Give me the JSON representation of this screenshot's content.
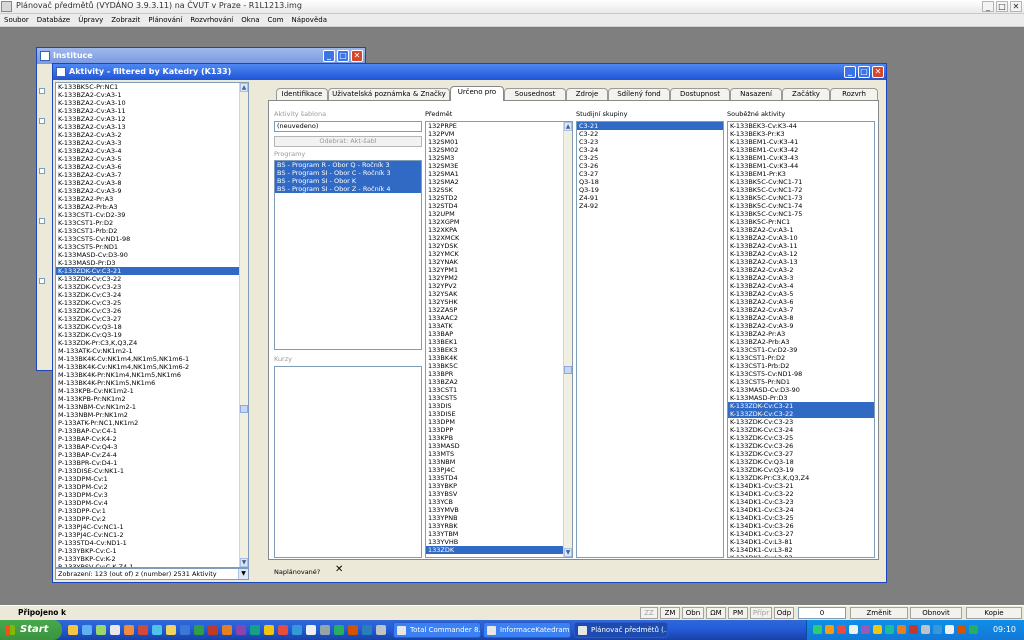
{
  "app": {
    "title": "Plánovač předmětů (VYDÁNO 3.9.3.11) na ČVUT v Praze - R1L1213.img",
    "ctrl_min": "_",
    "ctrl_max": "□",
    "ctrl_close": "✕"
  },
  "menu": [
    "Soubor",
    "Databáze",
    "Úpravy",
    "Zobrazit",
    "Plánování",
    "Rozvrhování",
    "Okna",
    "Com",
    "Nápověda"
  ],
  "instituce_window": {
    "title": "Instituce"
  },
  "aktivity_window": {
    "title": "Aktivity - filtered by Katedry (K133)",
    "list_items": [
      "K-133BK5C-Pr:NC1",
      "K-133BZA2-Cv:A3-1",
      "K-133BZA2-Cv:A3-10",
      "K-133BZA2-Cv:A3-11",
      "K-133BZA2-Cv:A3-12",
      "K-133BZA2-Cv:A3-13",
      "K-133BZA2-Cv:A3-2",
      "K-133BZA2-Cv:A3-3",
      "K-133BZA2-Cv:A3-4",
      "K-133BZA2-Cv:A3-5",
      "K-133BZA2-Cv:A3-6",
      "K-133BZA2-Cv:A3-7",
      "K-133BZA2-Cv:A3-8",
      "K-133BZA2-Cv:A3-9",
      "K-133BZA2-Pr:A3",
      "K-133BZA2-Prb:A3",
      "K-133CST1-Cv:D2-39",
      "K-133CST1-Pr:D2",
      "K-133CST1-Prb:D2",
      "K-133CST5-Cv:ND1-98",
      "K-133CST5-Pr:ND1",
      "K-133MASD-Cv:D3-90",
      "K-133MASD-Pr:D3",
      "K-133ZDK-Cv:C3-21",
      "K-133ZDK-Cv:C3-22",
      "K-133ZDK-Cv:C3-23",
      "K-133ZDK-Cv:C3-24",
      "K-133ZDK-Cv:C3-25",
      "K-133ZDK-Cv:C3-26",
      "K-133ZDK-Cv:C3-27",
      "K-133ZDK-Cv:Q3-18",
      "K-133ZDK-Cv:Q3-19",
      "K-133ZDK-Pr:C3,K,Q3,Z4",
      "M-133ATK-Cv:NK1m2-1",
      "M-133BK4K-Cv:NK1m4,NK1m5,NK1m6-1",
      "M-133BK4K-Cv:NK1m4,NK1m5,NK1m6-2",
      "M-133BK4K-Pr:NK1m4,NK1m5,NK1m6",
      "M-133BK4K-Pr:NK1m5,NK1m6",
      "M-133KPB-Cv:NK1m2-1",
      "M-133KPB-Pr:NK1m2",
      "M-133NBM-Cv:NK1m2-1",
      "M-133NBM-Pr:NK1m2",
      "P-133ATK-Pr:NC1,NK1m2",
      "P-133BAP-Cv:C4-1",
      "P-133BAP-Cv:K4-2",
      "P-133BAP-Cv:Q4-3",
      "P-133BAP-Cv:Z4-4",
      "P-133BPR-Cv:D4-1",
      "P-133DISE-Cv:NK1-1",
      "P-133DPM-Cv:1",
      "P-133DPM-Cv:2",
      "P-133DPM-Cv:3",
      "P-133DPM-Cv:4",
      "P-133DPP-Cv:1",
      "P-133DPP-Cv:2",
      "P-133PJ4C-Cv:NC1-1",
      "P-133PJ4C-Cv:NC1-2",
      "P-133STD4-Cv:ND1-1",
      "P-133YBKP-Cv:C-1",
      "P-133YBKP-Cv:K-2",
      "P-133YBSV-Cv:C,K,Z4-1"
    ],
    "selected_index": 23,
    "status": "Zobrazení: 123 (out of) z (number) 2531 Aktivity",
    "status_btn": "▼",
    "tabs": [
      "Identifikace",
      "Uživatelská poznámka & Značky",
      "Určeno pro",
      "Sousednost",
      "Zdroje",
      "Sdílený fond",
      "Dostupnost",
      "Nasazení",
      "Začátky",
      "Rozvrh"
    ],
    "active_tab": 2,
    "panel": {
      "sablona_label": "Aktivity šablona",
      "sablona_value": "(neuvedeno)",
      "odebrat_button": "Odebrat: Akt-šabl",
      "programy_label": "Programy",
      "programy": [
        "BS - Program R - Obor Q - Ročník 3",
        "BS - Program SI - Obor C - Ročník 3",
        "BS - Program SI - Obor K",
        "BS - Program SI - Obor Z - Ročník 4"
      ],
      "kurzy_label": "Kurzy",
      "predmet_label": "Předmět",
      "predmety": [
        "132PRPE",
        "132PVM",
        "132SM01",
        "132SM02",
        "132SM3",
        "132SM3E",
        "132SMA1",
        "132SMA2",
        "132SSK",
        "132STD2",
        "132STD4",
        "132UPM",
        "132XGPM",
        "132XKPA",
        "132XMCK",
        "132YDSK",
        "132YMCK",
        "132YNAK",
        "132YPM1",
        "132YPM2",
        "132YPV2",
        "132YSAK",
        "132YSHK",
        "132ZASP",
        "133AAC2",
        "133ATK",
        "133BAP",
        "133BEK1",
        "133BEK3",
        "133BK4K",
        "133BK5C",
        "133BPR",
        "133BZA2",
        "133CST1",
        "133CST5",
        "133DIS",
        "133DISE",
        "133DPM",
        "133DPP",
        "133KPB",
        "133MASD",
        "133MTS",
        "133NBM",
        "133PJ4C",
        "133STD4",
        "133YBKP",
        "133YBSV",
        "133YCB",
        "133YMVB",
        "133YPNB",
        "133YRBK",
        "133YTBM",
        "133YVHB",
        "133ZDK"
      ],
      "predmet_selected": 53,
      "skupiny_label": "Studijní skupiny",
      "skupiny": [
        "C3-21",
        "C3-22",
        "C3-23",
        "C3-24",
        "C3-25",
        "C3-26",
        "C3-27",
        "Q3-18",
        "Q3-19",
        "Z4-91",
        "Z4-92"
      ],
      "skupiny_selected": 0,
      "soubezne_label": "Souběžné aktivity",
      "soubezne": [
        "K-133BEK3-Cv:K3-44",
        "K-133BEK3-Pr:K3",
        "K-133BEM1-Cv:K3-41",
        "K-133BEM1-Cv:K3-42",
        "K-133BEM1-Cv:K3-43",
        "K-133BEM1-Cv:K3-44",
        "K-133BEM1-Pr:K3",
        "K-133BK5C-Cv:NC1-71",
        "K-133BK5C-Cv:NC1-72",
        "K-133BK5C-Cv:NC1-73",
        "K-133BK5C-Cv:NC1-74",
        "K-133BK5C-Cv:NC1-75",
        "K-133BK5C-Pr:NC1",
        "K-133BZA2-Cv:A3-1",
        "K-133BZA2-Cv:A3-10",
        "K-133BZA2-Cv:A3-11",
        "K-133BZA2-Cv:A3-12",
        "K-133BZA2-Cv:A3-13",
        "K-133BZA2-Cv:A3-2",
        "K-133BZA2-Cv:A3-3",
        "K-133BZA2-Cv:A3-4",
        "K-133BZA2-Cv:A3-5",
        "K-133BZA2-Cv:A3-6",
        "K-133BZA2-Cv:A3-7",
        "K-133BZA2-Cv:A3-8",
        "K-133BZA2-Cv:A3-9",
        "K-133BZA2-Pr:A3",
        "K-133BZA2-Prb:A3",
        "K-133CST1-Cv:D2-39",
        "K-133CST1-Pr:D2",
        "K-133CST1-Prb:D2",
        "K-133CST5-Cv:ND1-98",
        "K-133CST5-Pr:ND1",
        "K-133MASD-Cv:D3-90",
        "K-133MASD-Pr:D3",
        "K-133ZDK-Cv:C3-21",
        "K-133ZDK-Cv:C3-22",
        "K-133ZDK-Cv:C3-23",
        "K-133ZDK-Cv:C3-24",
        "K-133ZDK-Cv:C3-25",
        "K-133ZDK-Cv:C3-26",
        "K-133ZDK-Cv:C3-27",
        "K-133ZDK-Cv:Q3-18",
        "K-133ZDK-Cv:Q3-19",
        "K-133ZDK-Pr:C3,K,Q3,Z4",
        "K-134DK1-Cv:C3-21",
        "K-134DK1-Cv:C3-22",
        "K-134DK1-Cv:C3-23",
        "K-134DK1-Cv:C3-24",
        "K-134DK1-Cv:C3-25",
        "K-134DK1-Cv:C3-26",
        "K-134DK1-Cv:C3-27",
        "K-134DK1-Cv:L3-81",
        "K-134DK1-Cv:L3-82",
        "K-134DK1-Cv:L3-83"
      ],
      "soubezne_selected": [
        35,
        36
      ],
      "naplanovane_label": "Naplánované?",
      "naplanovane_value": "✕"
    }
  },
  "statusbar": {
    "text": "Připojeno k",
    "buttons": [
      "ZZ",
      "ZM",
      "Obn",
      "ΩM",
      "PM",
      "Přípr",
      "Odp"
    ],
    "counter": "0",
    "zmenit": "Změnit",
    "obnovit": "Obnovit",
    "kopie": "Kopie"
  },
  "taskbar": {
    "start_label": "Start",
    "tasks": [
      "Total Commander 8.0...",
      "InformaceKatedram2...",
      "Plánovač předmětů (..."
    ],
    "clock": "09:10"
  }
}
